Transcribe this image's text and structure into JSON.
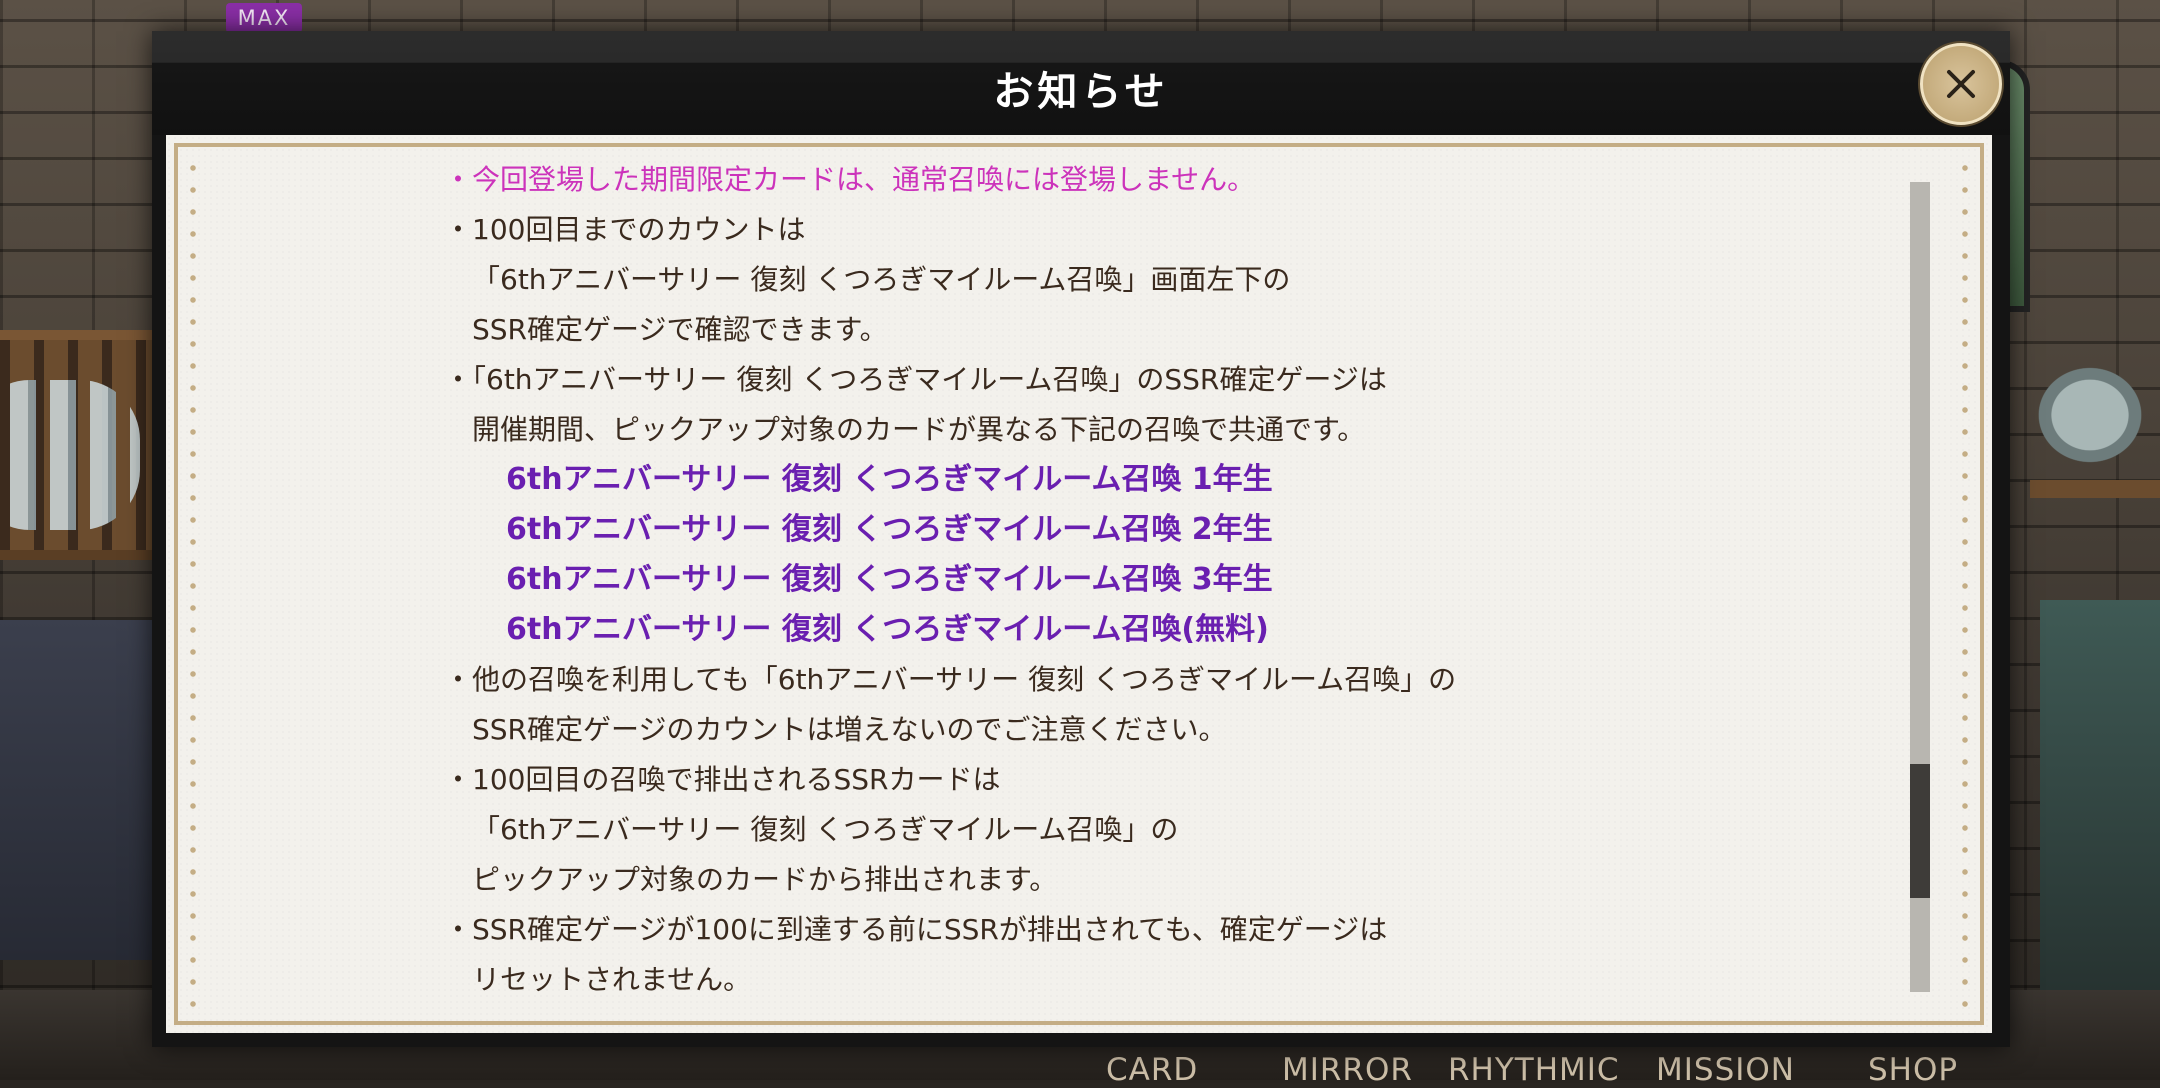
{
  "badge": {
    "label": "MAX"
  },
  "bottom_nav": [
    "CARD",
    "MIRROR",
    "RHYTHMIC",
    "MISSION",
    "SHOP"
  ],
  "dialog": {
    "title": "お知らせ",
    "lines": [
      {
        "style": "pink",
        "text": "・今回登場した期間限定カードは、通常召喚には登場しません。"
      },
      {
        "style": "normal",
        "text": "・100回目までのカウントは"
      },
      {
        "style": "indent",
        "text": "「6thアニバーサリー 復刻 くつろぎマイルーム召喚」画面左下の"
      },
      {
        "style": "indent",
        "text": "SSR確定ゲージで確認できます。"
      },
      {
        "style": "normal",
        "text": "・「6thアニバーサリー 復刻 くつろぎマイルーム召喚」のSSR確定ゲージは"
      },
      {
        "style": "indent",
        "text": "開催期間、ピックアップ対象のカードが異なる下記の召喚で共通です。"
      },
      {
        "style": "purple",
        "text": "6thアニバーサリー 復刻 くつろぎマイルーム召喚 1年生"
      },
      {
        "style": "purple",
        "text": "6thアニバーサリー 復刻 くつろぎマイルーム召喚 2年生"
      },
      {
        "style": "purple",
        "text": "6thアニバーサリー 復刻 くつろぎマイルーム召喚 3年生"
      },
      {
        "style": "purple",
        "text": "6thアニバーサリー 復刻 くつろぎマイルーム召喚(無料)"
      },
      {
        "style": "normal",
        "text": "・他の召喚を利用しても「6thアニバーサリー 復刻 くつろぎマイルーム召喚」の"
      },
      {
        "style": "indent",
        "text": "SSR確定ゲージのカウントは増えないのでご注意ください。"
      },
      {
        "style": "normal",
        "text": "・100回目の召喚で排出されるSSRカードは"
      },
      {
        "style": "indent",
        "text": "「6thアニバーサリー 復刻 くつろぎマイルーム召喚」の"
      },
      {
        "style": "indent",
        "text": "ピックアップ対象のカードから排出されます。"
      },
      {
        "style": "normal",
        "text": "・SSR確定ゲージが100に到達する前にSSRが排出されても、確定ゲージは"
      },
      {
        "style": "indent",
        "text": "リセットされません。"
      }
    ]
  },
  "colors": {
    "pink_text": "#cc33bb",
    "purple_text": "#6a1fb0",
    "body_text": "#3a2a1e",
    "paper": "#f3f1ec",
    "gold_border": "#c4ad85"
  },
  "icons": {
    "close": "close-x-icon"
  }
}
